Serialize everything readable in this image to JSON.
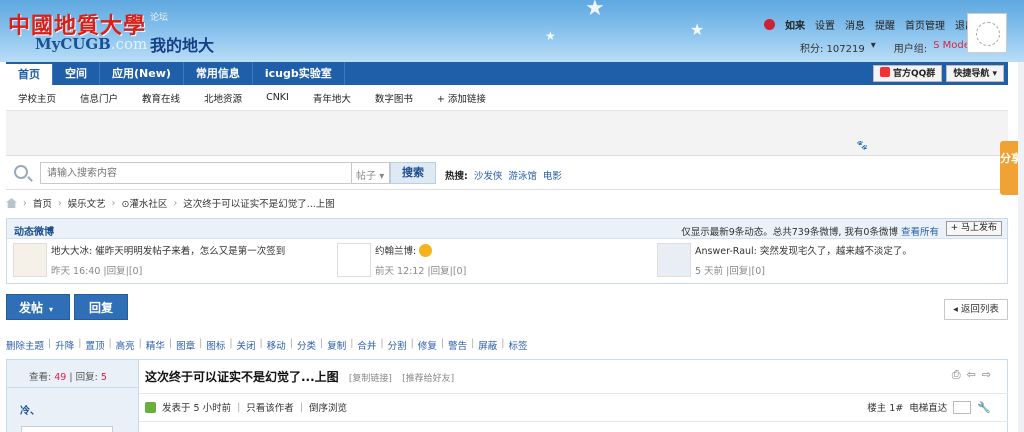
{
  "header": {
    "logo_cn": "中國地質大學",
    "logo_tag": "论坛",
    "logo_en": "MyCUGB",
    "logo_en_suffix": ".com",
    "slogan": "我的地大",
    "user": {
      "name": "如来",
      "links": [
        "设置",
        "消息",
        "提醒",
        "首页管理",
        "退出"
      ],
      "points_label": "积分: 107219",
      "group_label": "用户组:",
      "group_value": "S Moderator"
    }
  },
  "nav": {
    "items": [
      "首页",
      "空间",
      "应用(New)",
      "常用信息",
      "icugb实验室"
    ],
    "qq_button": "官方QQ群",
    "quick_nav": "快捷导航"
  },
  "subnav": [
    "学校主页",
    "信息门户",
    "教育在线",
    "北地资源",
    "CNKI",
    "青年地大",
    "数字图书",
    "+ 添加链接"
  ],
  "search": {
    "placeholder": "请输入搜索内容",
    "type": "帖子",
    "button": "搜索",
    "hot_label": "热搜:",
    "hot_links": [
      "沙发侠",
      "游泳馆",
      "电影"
    ]
  },
  "breadcrumb": [
    "首页",
    "娱乐文艺",
    "⊙灌水社区",
    "这次终于可以证实不是幻觉了...上图"
  ],
  "weibo": {
    "title": "动态微博",
    "info": "仅显示最新9条动态。总共739条微博, 我有0条微博",
    "view_all": "查看所有",
    "post_button": "+ 马上发布",
    "feed": [
      {
        "author": "地大大冰:",
        "text": "催昨天明明发帖子来着，怎么又是第一次签到",
        "meta": "昨天 16:40 |回复|[0]"
      },
      {
        "author": "约翰兰博:",
        "text": "",
        "meta": "前天 12:12 |回复|[0]"
      },
      {
        "author": "Answer-Raul:",
        "text": "突然发现宅久了，越来越不淡定了。",
        "meta": "5 天前 |回复|[0]"
      }
    ]
  },
  "actions": {
    "post": "发帖",
    "reply": "回复",
    "back": "返回列表"
  },
  "mod_tools": [
    "删除主题",
    "升降",
    "置顶",
    "高亮",
    "精华",
    "图章",
    "图标",
    "关闭",
    "移动",
    "分类",
    "复制",
    "合并",
    "分割",
    "修复",
    "警告",
    "屏蔽",
    "标签"
  ],
  "thread": {
    "views_label": "查看:",
    "views": "49",
    "replies_label": "回复:",
    "replies": "5",
    "title": "这次终于可以证实不是幻觉了...上图",
    "copy_link": "[复制链接]",
    "recommend": "[推荐给好友]",
    "author": "冷、",
    "posted": "发表于 5 小时前",
    "only_author": "只看该作者",
    "reverse": "倒序浏览",
    "floor": "楼主 1#",
    "elevator": "电梯直达"
  },
  "share_tab": "分享"
}
